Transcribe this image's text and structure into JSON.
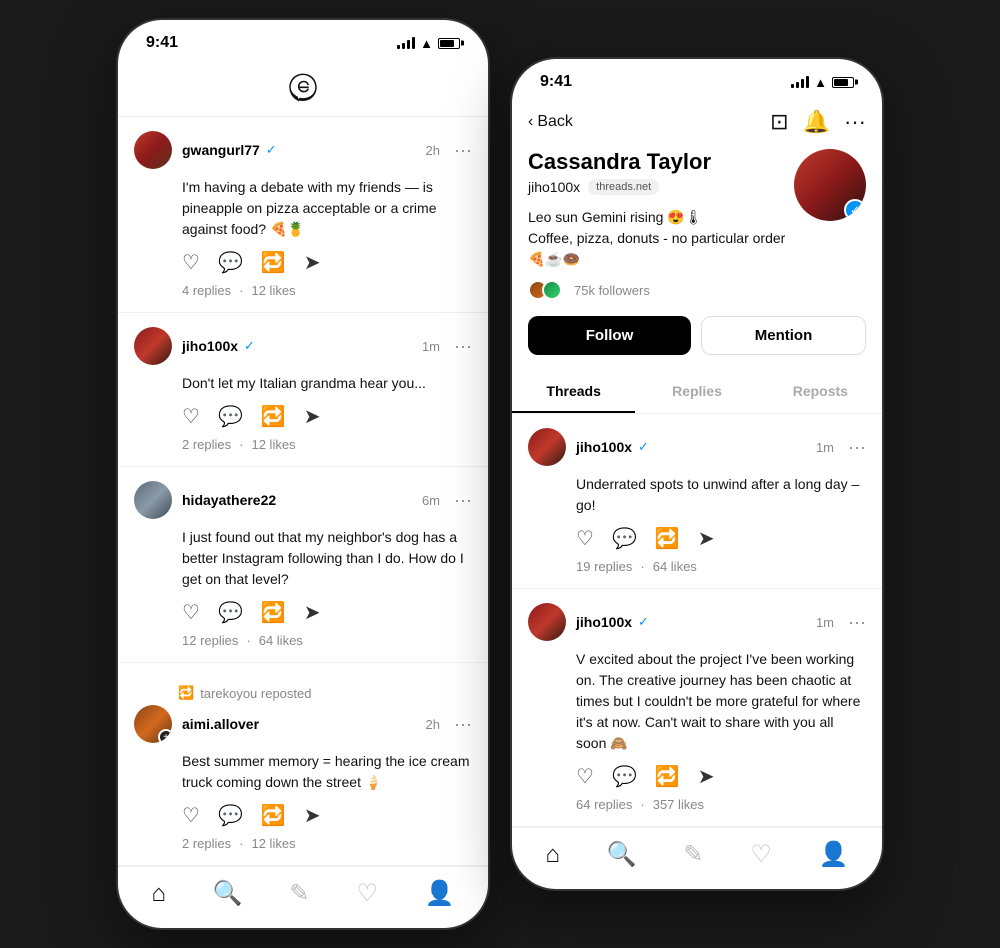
{
  "left_phone": {
    "status_time": "9:41",
    "posts": [
      {
        "id": "post1",
        "username": "gwangurl77",
        "verified": true,
        "time": "2h",
        "content": "I'm having a debate with my friends — is pineapple on pizza acceptable or a crime against food? 🍕🍍",
        "replies": "4 replies",
        "likes": "12 likes"
      },
      {
        "id": "post2",
        "username": "jiho100x",
        "verified": true,
        "time": "1m",
        "content": "Don't let my Italian grandma hear you...",
        "replies": "2 replies",
        "likes": "12 likes"
      },
      {
        "id": "post3",
        "username": "hidayathere22",
        "verified": false,
        "time": "6m",
        "content": "I just found out that my neighbor's dog has a better Instagram following than I do. How do I get on that level?",
        "replies": "12 replies",
        "likes": "64 likes"
      },
      {
        "id": "post4",
        "repost_by": "tarekoyou reposted",
        "username": "aimi.allover",
        "verified": false,
        "time": "2h",
        "content": "Best summer memory = hearing the ice cream truck coming down the street 🍦",
        "replies": "2 replies",
        "likes": "12 likes"
      }
    ],
    "nav": {
      "home": "home",
      "search": "search",
      "compose": "compose",
      "likes": "likes",
      "profile": "profile"
    }
  },
  "right_phone": {
    "status_time": "9:41",
    "back_label": "Back",
    "profile": {
      "name": "Cassandra Taylor",
      "handle": "jiho100x",
      "handle_badge": "threads.net",
      "bio_line1": "Leo sun Gemini rising 😍🌡",
      "bio_line2": "Coffee, pizza, donuts - no particular order 🍕☕🍩",
      "followers": "75k followers",
      "follow_label": "Follow",
      "mention_label": "Mention"
    },
    "tabs": {
      "threads": "Threads",
      "replies": "Replies",
      "reposts": "Reposts"
    },
    "posts": [
      {
        "id": "profile_post1",
        "username": "jiho100x",
        "verified": true,
        "time": "1m",
        "content": "Underrated spots to unwind after a long day – go!",
        "replies": "19 replies",
        "likes": "64 likes"
      },
      {
        "id": "profile_post2",
        "username": "jiho100x",
        "verified": true,
        "time": "1m",
        "content": "V excited about the project I've been working on. The creative journey has been chaotic at times but I couldn't be more grateful for where it's at now. Can't wait to share with you all soon 🙈",
        "replies": "64 replies",
        "likes": "357 likes"
      }
    ],
    "nav": {
      "home": "home",
      "search": "search",
      "compose": "compose",
      "likes": "likes",
      "profile": "profile"
    }
  }
}
